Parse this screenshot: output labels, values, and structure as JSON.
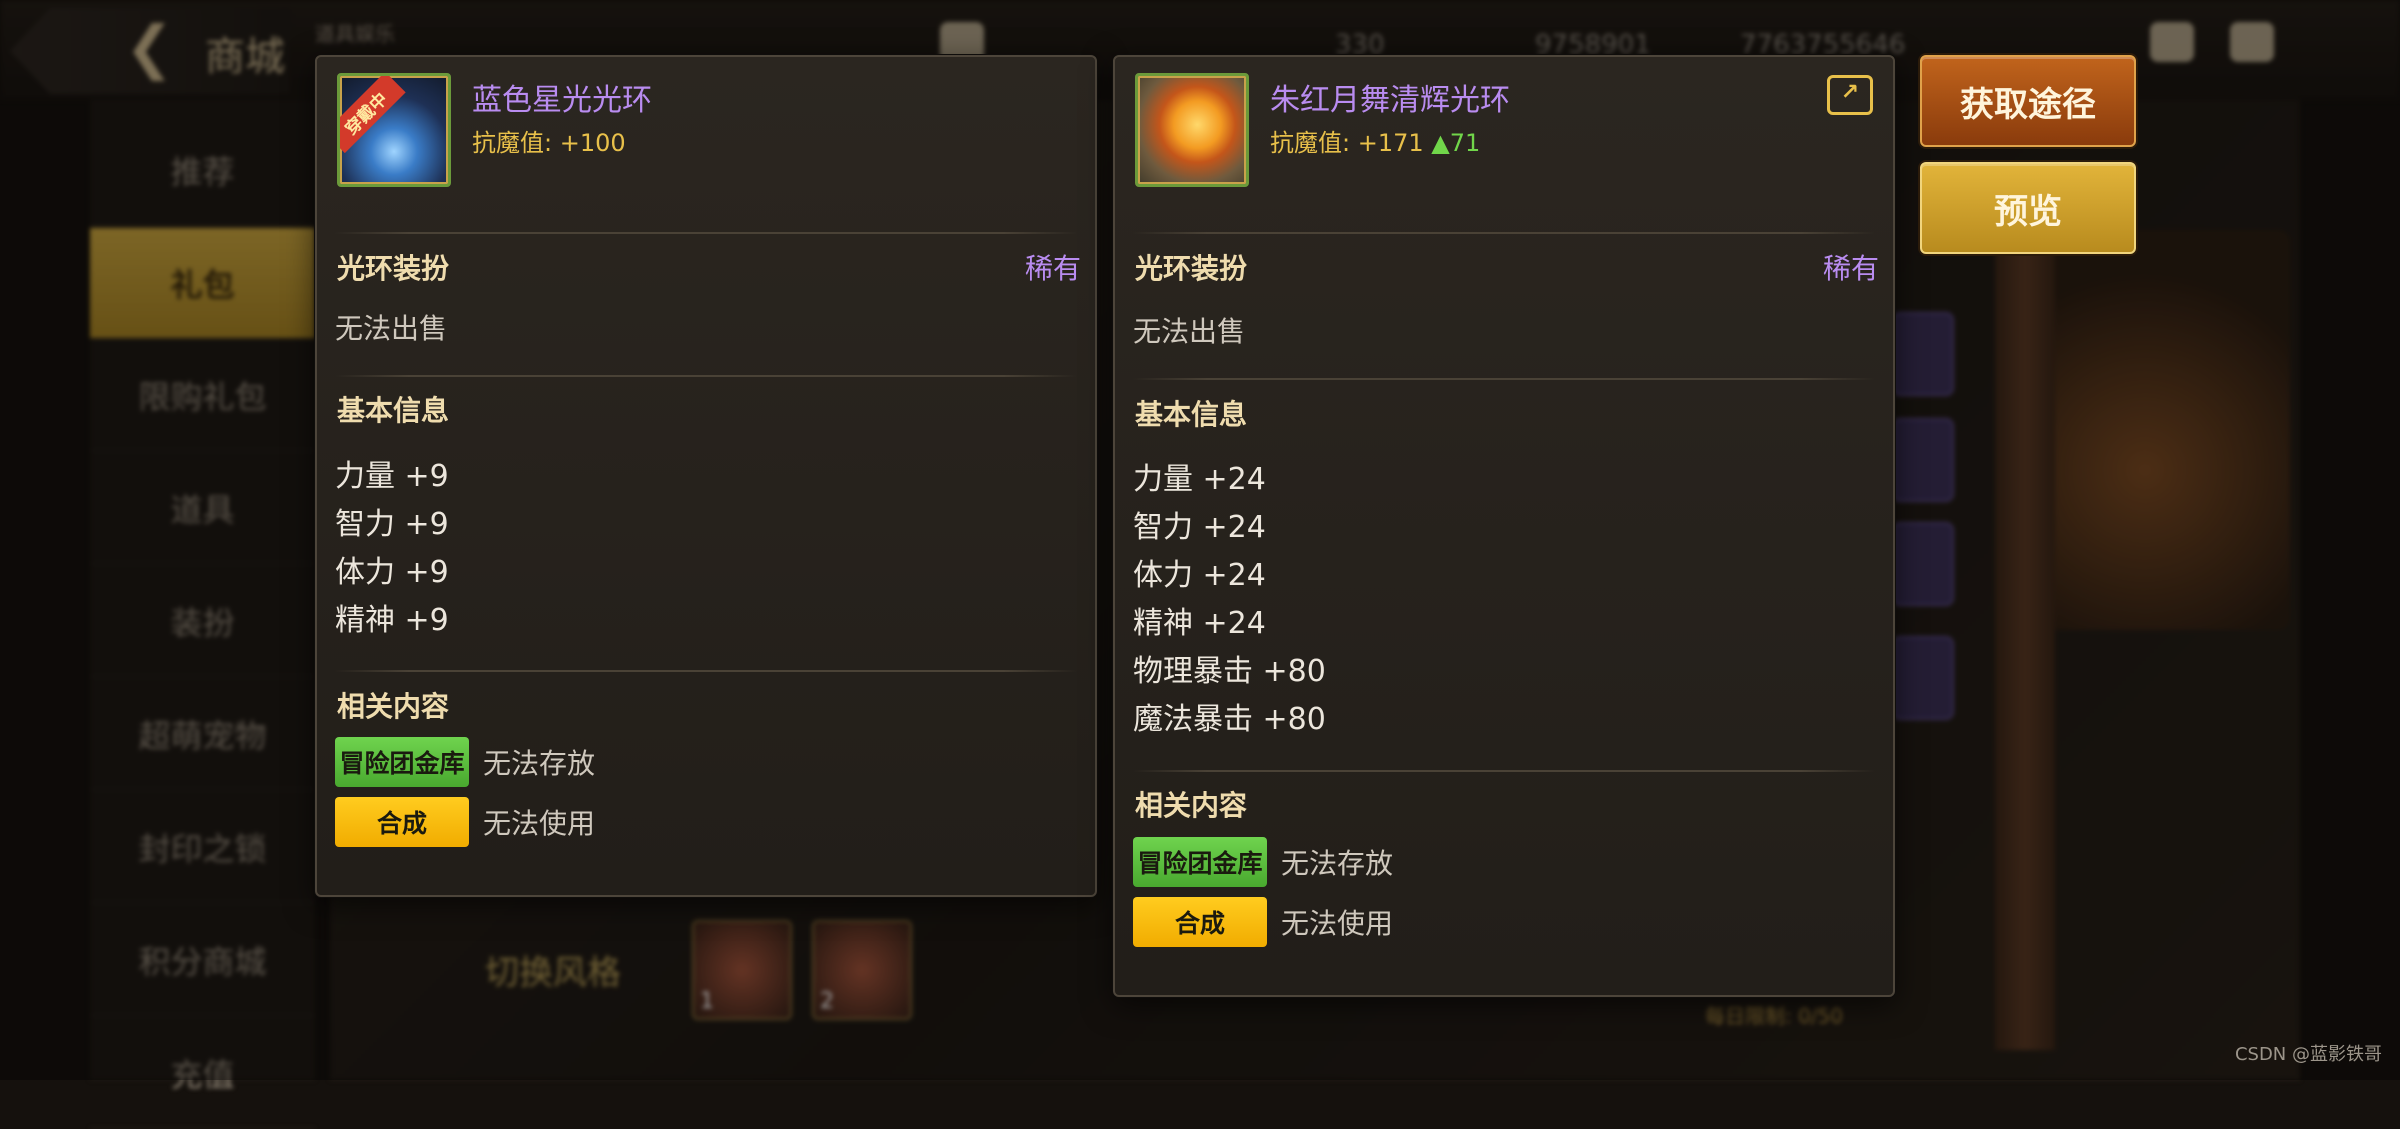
{
  "background": {
    "header": {
      "title": "商城",
      "subtitle": "道具娱乐",
      "stats": [
        "330",
        "9758901",
        "7763755646"
      ]
    },
    "sidebar": {
      "items": [
        {
          "label": "推荐"
        },
        {
          "label": "礼包",
          "active": true
        },
        {
          "label": "限购礼包"
        },
        {
          "label": "道具"
        },
        {
          "label": "装扮"
        },
        {
          "label": "超萌宠物"
        },
        {
          "label": "封印之锁"
        },
        {
          "label": "积分商城"
        },
        {
          "label": "充值"
        }
      ]
    },
    "switch_style_label": "切换风格",
    "portrait_numbers": [
      "1",
      "2"
    ],
    "daily_limit": "每日限制: 0/50"
  },
  "panel_left": {
    "item_name": "蓝色星光光环",
    "equipped_tag": "穿戴中",
    "resist_label": "抗魔值:",
    "resist_value": "+100",
    "category": "光环装扮",
    "rarity": "稀有",
    "sell_status": "无法出售",
    "basic_info_title": "基本信息",
    "stats": [
      "力量 +9",
      "智力 +9",
      "体力 +9",
      "精神 +9"
    ],
    "related_title": "相关内容",
    "related": [
      {
        "tag": "冒险团金库",
        "desc": "无法存放",
        "color": "#5cc23e"
      },
      {
        "tag": "合成",
        "desc": "无法使用",
        "color": "#f7bd0c"
      }
    ]
  },
  "panel_right": {
    "item_name": "朱红月舞清辉光环",
    "resist_label": "抗魔值:",
    "resist_value": "+171",
    "resist_diff": "▲71",
    "category": "光环装扮",
    "rarity": "稀有",
    "sell_status": "无法出售",
    "basic_info_title": "基本信息",
    "stats": [
      "力量 +24",
      "智力 +24",
      "体力 +24",
      "精神 +24",
      "物理暴击 +80",
      "魔法暴击 +80"
    ],
    "related_title": "相关内容",
    "related": [
      {
        "tag": "冒险团金库",
        "desc": "无法存放",
        "color": "#5cc23e"
      },
      {
        "tag": "合成",
        "desc": "无法使用",
        "color": "#f7bd0c"
      }
    ]
  },
  "buttons": {
    "obtain": "获取途径",
    "preview": "预览"
  },
  "watermark": "CSDN @蓝影铁哥",
  "colors": {
    "rarity_purple": "#b98cf0",
    "resist_gold": "#e8c04a",
    "increase_green": "#71d64a"
  }
}
